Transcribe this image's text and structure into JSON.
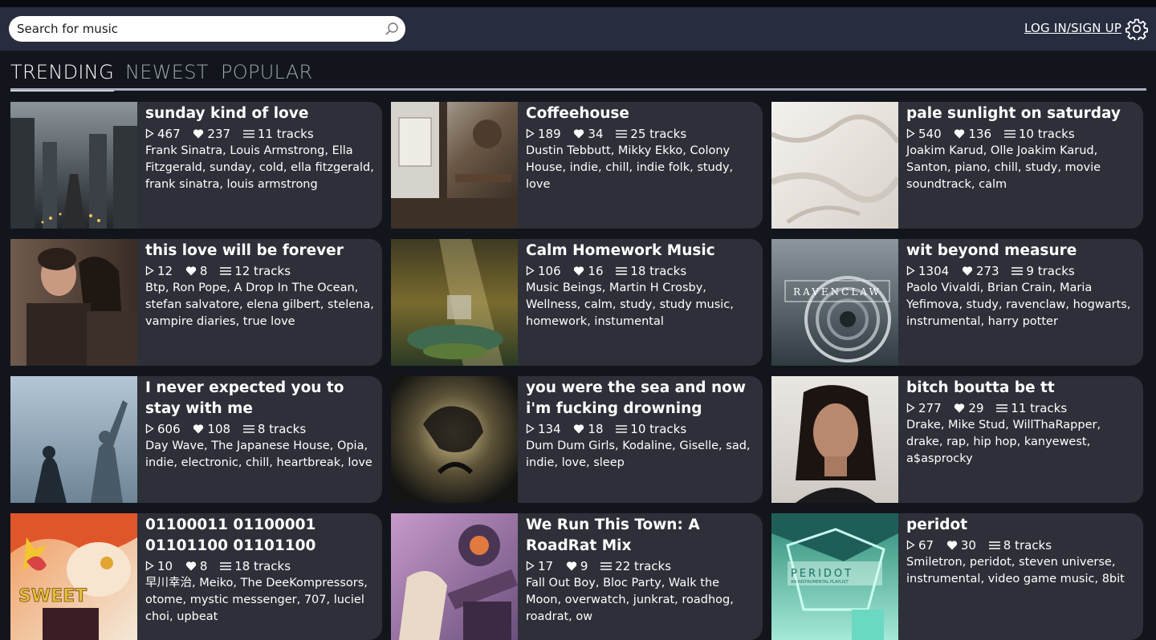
{
  "search": {
    "placeholder": "Search for music",
    "icon": "search-icon"
  },
  "header": {
    "login_label": "LOG IN/SIGN UP",
    "settings_icon": "gear-icon"
  },
  "tabs": [
    {
      "label": "TRENDING",
      "active": true
    },
    {
      "label": "NEWEST",
      "active": false
    },
    {
      "label": "POPULAR",
      "active": false
    }
  ],
  "playlists": [
    {
      "title": "sunday kind of love",
      "plays": "467",
      "likes": "237",
      "tracks": "11 tracks",
      "tags": "Frank Sinatra, Louis Armstrong, Ella Fitzgerald, sunday, cold, ella fitzgerald, frank sinatra, louis armstrong"
    },
    {
      "title": "Coffeehouse",
      "plays": "189",
      "likes": "34",
      "tracks": "25 tracks",
      "tags": "Dustin Tebbutt, Mikky Ekko, Colony House, indie, chill, indie folk, study, love"
    },
    {
      "title": "pale sunlight on saturday",
      "plays": "540",
      "likes": "136",
      "tracks": "10 tracks",
      "tags": "Joakim Karud, Olle Joakim Karud, Santon, piano, chill, study, movie soundtrack, calm"
    },
    {
      "title": "this love will be forever",
      "plays": "12",
      "likes": "8",
      "tracks": "12 tracks",
      "tags": "Btp, Ron Pope, A Drop In The Ocean, stefan salvatore, elena gilbert, stelena, vampire diaries, true love"
    },
    {
      "title": "Calm Homework Music",
      "plays": "106",
      "likes": "16",
      "tracks": "18 tracks",
      "tags": "Music Beings, Martin H Crosby, Wellness, calm, study, study music, homework, instumental"
    },
    {
      "title": "wit beyond measure",
      "plays": "1304",
      "likes": "273",
      "tracks": "9 tracks",
      "tags": "Paolo Vivaldi, Brian Crain, Maria Yefimova, study, ravenclaw, hogwarts, instrumental, harry potter"
    },
    {
      "title": "I never expected you to stay with me",
      "plays": "606",
      "likes": "108",
      "tracks": "8 tracks",
      "tags": "Day Wave, The Japanese House, Opia, indie, electronic, chill, heartbreak, love"
    },
    {
      "title": "you were the sea and now i'm fucking drowning",
      "plays": "134",
      "likes": "18",
      "tracks": "10 tracks",
      "tags": "Dum Dum Girls, Kodaline, Giselle, sad, indie, love, sleep"
    },
    {
      "title": "bitch boutta be tt",
      "plays": "277",
      "likes": "29",
      "tracks": "11 tracks",
      "tags": "Drake, Mike Stud, WillThaRapper, drake, rap, hip hop, kanyewest, a$asprocky"
    },
    {
      "title": "01100011 01100001 01101100 01101100",
      "plays": "10",
      "likes": "8",
      "tracks": "18 tracks",
      "tags": "早川幸治, Meiko, The DeeKompressors, otome, mystic messenger, 707, luciel choi, upbeat"
    },
    {
      "title": "We Run This Town: A RoadRat Mix",
      "plays": "17",
      "likes": "9",
      "tracks": "22 tracks",
      "tags": "Fall Out Boy, Bloc Party, Walk the Moon, overwatch, junkrat, roadhog, roadrat, ow"
    },
    {
      "title": "peridot",
      "plays": "67",
      "likes": "30",
      "tracks": "8 tracks",
      "tags": "Smiletron, peridot, steven universe, instrumental, video game music, 8bit"
    }
  ],
  "thumb_text": {
    "ravenclaw": "RAVENCLAW",
    "peridot": "PERIDOT",
    "peridot_sub": "AN INSTRUMENTAL PLAYLIST",
    "sweet": "SWEET"
  }
}
